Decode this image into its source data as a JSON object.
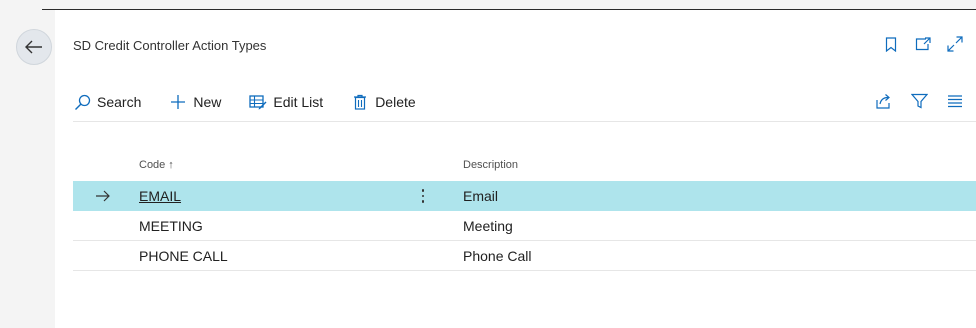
{
  "page": {
    "title": "SD Credit Controller Action Types"
  },
  "toolbar": {
    "search_label": "Search",
    "new_label": "New",
    "edit_list_label": "Edit List",
    "delete_label": "Delete"
  },
  "grid": {
    "columns": {
      "code": "Code",
      "code_sort": "↑",
      "description": "Description"
    },
    "rows": [
      {
        "code": "EMAIL",
        "description": "Email",
        "selected": true
      },
      {
        "code": "MEETING",
        "description": "Meeting",
        "selected": false
      },
      {
        "code": "PHONE CALL",
        "description": "Phone Call",
        "selected": false
      }
    ]
  },
  "colors": {
    "selected_row": "#aee4ec",
    "accent": "#0f6cbd",
    "background": "#f4f4f4"
  },
  "icons": {
    "back": "arrow-left-icon",
    "bookmark": "bookmark-icon",
    "open_new_window": "open-in-new-window-icon",
    "expand": "expand-icon",
    "search": "search-icon",
    "new": "plus-icon",
    "edit_list": "edit-list-icon",
    "delete": "trash-icon",
    "share": "share-icon",
    "filter": "filter-icon",
    "list_view": "list-view-icon"
  }
}
